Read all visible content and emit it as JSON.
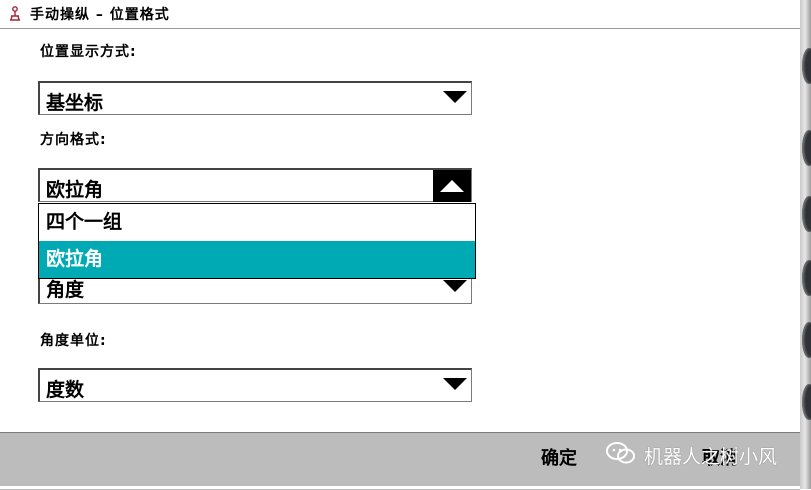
{
  "window": {
    "title": "手动操纵 – 位置格式",
    "icon": "robot-icon"
  },
  "position_display": {
    "label": "位置显示方式:",
    "value": "基坐标"
  },
  "orientation_format": {
    "label": "方向格式:",
    "value": "欧拉角",
    "options": [
      "四个一组",
      "欧拉角"
    ],
    "selected_option": "欧拉角"
  },
  "hidden_combo": {
    "value": "角度"
  },
  "angle_unit": {
    "label": "角度单位:",
    "value": "度数"
  },
  "footer": {
    "ok_label": "确定",
    "cancel_label": "取消"
  },
  "watermark": {
    "text": "机器人之树小风"
  },
  "colors": {
    "selected_bg": "#00aab5",
    "footer_bg": "#bcbcbc"
  }
}
